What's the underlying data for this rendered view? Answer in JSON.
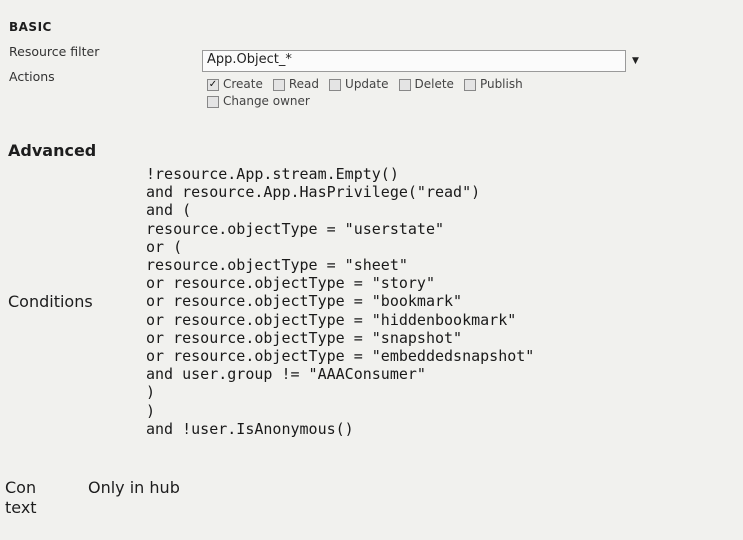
{
  "basic": {
    "heading": "BASIC",
    "resource_filter_label": "Resource filter",
    "resource_filter_value": "App.Object_*",
    "actions_label": "Actions",
    "actions": [
      {
        "label": "Create",
        "checked": true
      },
      {
        "label": "Read",
        "checked": false
      },
      {
        "label": "Update",
        "checked": false
      },
      {
        "label": "Delete",
        "checked": false
      },
      {
        "label": "Publish",
        "checked": false
      },
      {
        "label": "Change owner",
        "checked": false
      }
    ]
  },
  "advanced": {
    "heading": "Advanced",
    "conditions_label": "Conditions",
    "conditions_lines": [
      "!resource.App.stream.Empty()",
      "and resource.App.HasPrivilege(\"read\")",
      "and (",
      "resource.objectType = \"userstate\"",
      "or (",
      "resource.objectType = \"sheet\"",
      "or resource.objectType = \"story\"",
      "or resource.objectType = \"bookmark\"",
      "or resource.objectType = \"hiddenbookmark\"",
      "or resource.objectType = \"snapshot\"",
      "or resource.objectType = \"embeddedsnapshot\"",
      "and user.group != \"AAAConsumer\"",
      ")",
      ")",
      "and !user.IsAnonymous()"
    ]
  },
  "context": {
    "label_line1": "Con",
    "label_line2": "text",
    "value": "Only in hub"
  }
}
